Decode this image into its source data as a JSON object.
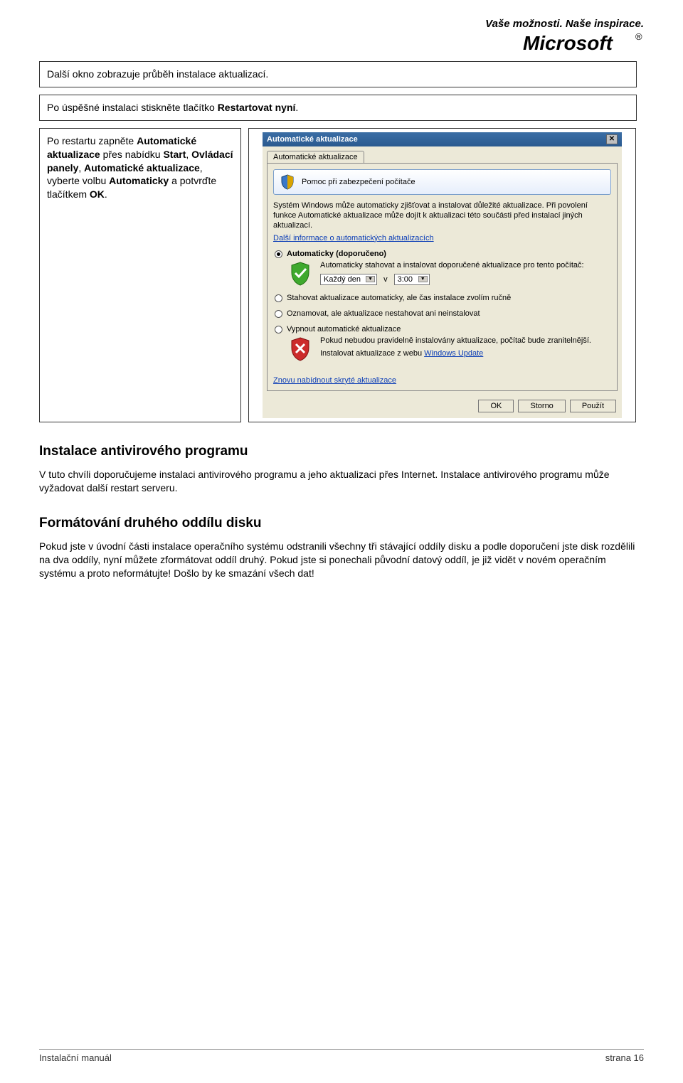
{
  "header": {
    "tagline": "Vaše možnosti. Naše inspirace."
  },
  "box1": {
    "text": "Další okno zobrazuje průběh instalace aktualizací."
  },
  "box2": {
    "pre": "Po úspěšné instalaci stiskněte tlačítko ",
    "bold": "Restartovat nyní",
    "post": "."
  },
  "box3": {
    "p1a": "Po restartu zapněte ",
    "p1b": "Automatické aktualizace",
    "p1c": " přes nabídku ",
    "p1d": "Start",
    "p1e": ", ",
    "p1f": "Ovládací panely",
    "p1g": ", ",
    "p1h": "Automatické aktualizace",
    "p1i": ", vyberte volbu ",
    "p1j": "Automaticky",
    "p1k": " a potvrďte tlačítkem ",
    "p1l": "OK",
    "p1m": "."
  },
  "dialog": {
    "title": "Automatické aktualizace",
    "tab": "Automatické aktualizace",
    "infobar": "Pomoc při zabezpečení počítače",
    "desc": "Systém Windows může automaticky zjišťovat a instalovat důležité aktualizace. Při povolení funkce Automatické aktualizace může dojít k aktualizaci této součásti před instalací jiných aktualizací.",
    "moreinfo": "Další informace o automatických aktualizacích",
    "opt1": "Automaticky (doporučeno)",
    "opt1_sub": "Automaticky stahovat a instalovat doporučené aktualizace pro tento počítač:",
    "dd_day": "Každý den",
    "dd_sep": "v",
    "dd_time": "3:00",
    "opt2": "Stahovat aktualizace automaticky, ale čas instalace zvolím ručně",
    "opt3": "Oznamovat, ale aktualizace nestahovat ani neinstalovat",
    "opt4": "Vypnout automatické aktualizace",
    "opt4_warn": "Pokud nebudou pravidelně instalovány aktualizace, počítač bude zranitelnější.",
    "opt4_link_pre": "Instalovat aktualizace z webu ",
    "opt4_link": "Windows Update",
    "restore_hidden": "Znovu nabídnout skryté aktualizace",
    "btn_ok": "OK",
    "btn_cancel": "Storno",
    "btn_apply": "Použít"
  },
  "section1_title": "Instalace antivirového programu",
  "section1_p1": "V tuto chvíli doporučujeme instalaci antivirového programu a jeho aktualizaci přes Internet. Instalace antivirového programu může vyžadovat další restart serveru.",
  "section2_title": "Formátování druhého oddílu disku",
  "section2_p1": "Pokud jste v úvodní části instalace operačního systému odstranili všechny tři stávající oddíly disku a podle doporučení jste disk rozdělili na dva oddíly, nyní můžete zformátovat oddíl druhý. Pokud jste si ponechali původní datový oddíl, je již vidět v novém operačním systému a proto neformátujte! Došlo by ke smazání všech dat!",
  "footer": {
    "left": "Instalační manuál",
    "right": "strana 16"
  }
}
